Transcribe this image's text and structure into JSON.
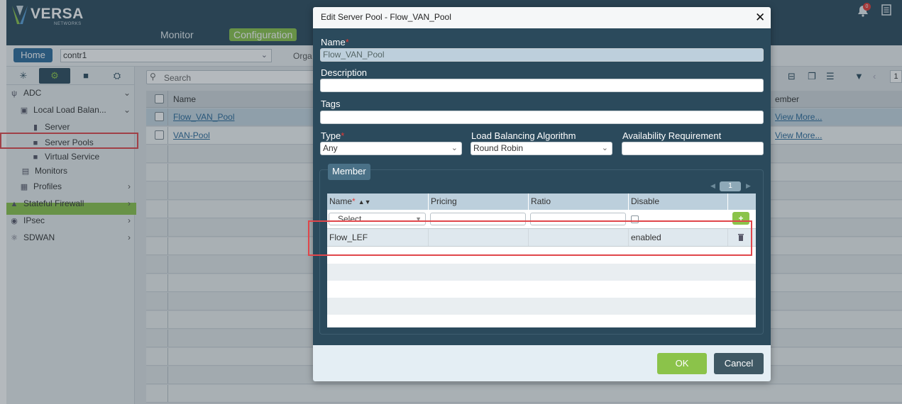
{
  "app": {
    "logo_text": "VERSA",
    "logo_sub": "NETWORKS",
    "nav": {
      "monitor": "Monitor",
      "configuration": "Configuration"
    },
    "notification_count": "0",
    "home_label": "Home",
    "tenant_value": "contr1",
    "org_label": "Orga"
  },
  "sidebar": {
    "tree": [
      {
        "label": "ADC",
        "icon": "adc-icon"
      },
      {
        "label": "Local Load Balan...",
        "icon": "load-balancer-icon"
      },
      {
        "label": "Server",
        "icon": "server-icon"
      },
      {
        "label": "Server Pools",
        "icon": "cube-icon"
      },
      {
        "label": "Virtual Service",
        "icon": "cube-icon"
      },
      {
        "label": "Monitors",
        "icon": "monitor-icon"
      },
      {
        "label": "Profiles",
        "icon": "profiles-icon"
      },
      {
        "label": "Stateful Firewall",
        "icon": "firewall-icon"
      },
      {
        "label": "IPsec",
        "icon": "ipsec-icon"
      },
      {
        "label": "SDWAN",
        "icon": "sdwan-icon"
      }
    ]
  },
  "main": {
    "search_placeholder": "Search",
    "columns": {
      "name": "Name",
      "member": "ember"
    },
    "rows": [
      {
        "name": "Flow_VAN_Pool",
        "member": "View More..."
      },
      {
        "name": "VAN-Pool",
        "member": "View More..."
      }
    ],
    "pager": "1"
  },
  "modal": {
    "title": "Edit Server Pool - Flow_VAN_Pool",
    "fields": {
      "name_label": "Name",
      "name_value": "Flow_VAN_Pool",
      "description_label": "Description",
      "description_value": "",
      "tags_label": "Tags",
      "tags_value": "",
      "type_label": "Type",
      "type_value": "Any",
      "lb_algo_label": "Load Balancing Algorithm",
      "lb_algo_value": "Round Robin",
      "availability_label": "Availability Requirement",
      "availability_value": ""
    },
    "member": {
      "legend": "Member",
      "page": "1",
      "columns": [
        "Name",
        "Pricing",
        "Ratio",
        "Disable"
      ],
      "select_placeholder": "Select",
      "rows": [
        {
          "name": "Flow_LEF",
          "pricing": "",
          "ratio": "",
          "disable": "enabled"
        }
      ]
    },
    "buttons": {
      "ok": "OK",
      "cancel": "Cancel"
    }
  },
  "colors": {
    "header_bg": "#2b4a5c",
    "accent_green": "#8bc34a",
    "highlight_red": "#e0464a",
    "link_blue": "#2b6a9a"
  }
}
